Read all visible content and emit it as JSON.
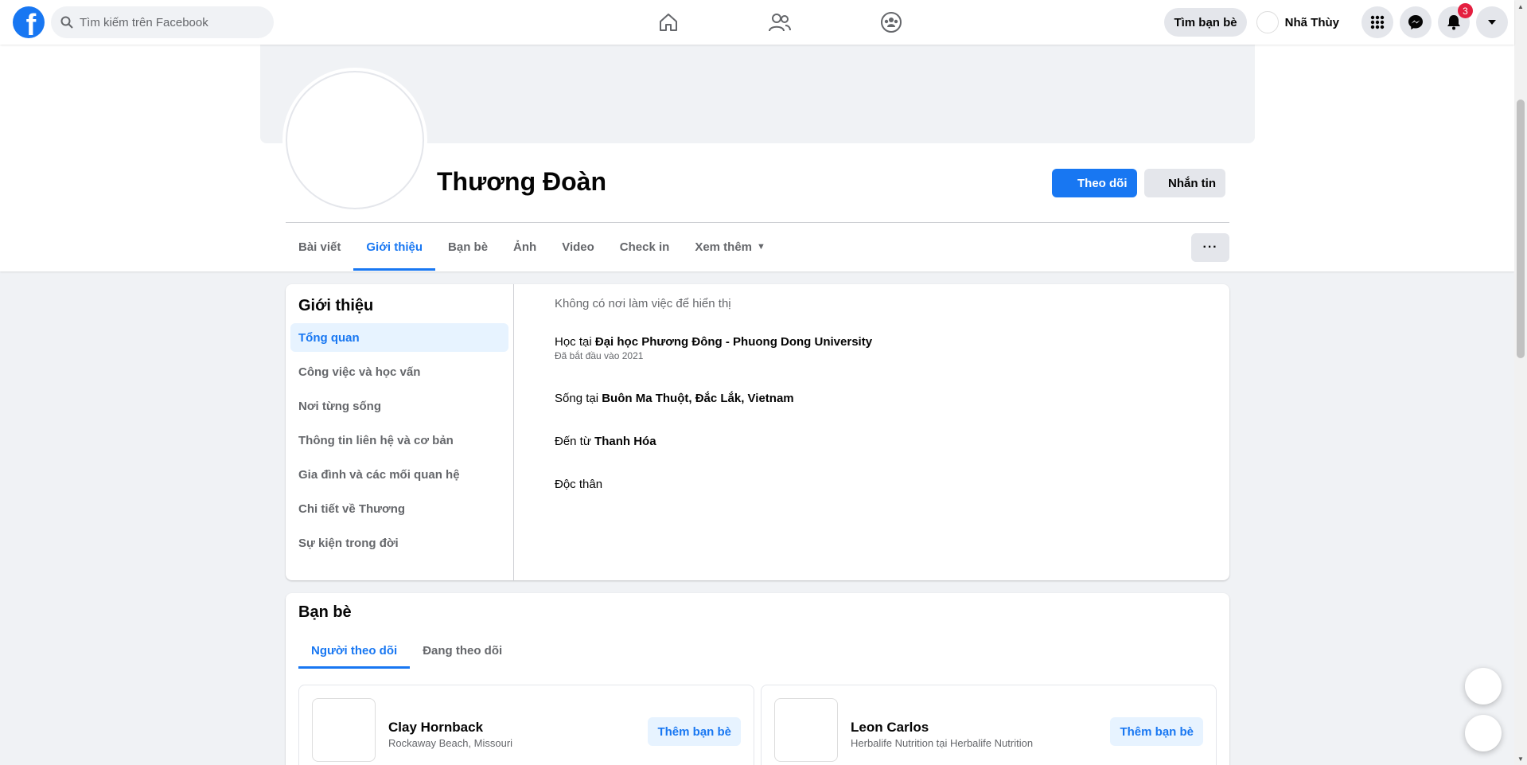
{
  "topbar": {
    "search_placeholder": "Tìm kiếm trên Facebook",
    "find_friends_label": "Tìm bạn bè",
    "user_name": "Nhã Thùy",
    "notification_count": "3",
    "brand_color": "#1877f2"
  },
  "profile": {
    "name": "Thương Đoàn",
    "follow_label": "Theo dõi",
    "message_label": "Nhắn tin",
    "more_label": "···",
    "tabs": [
      {
        "label": "Bài viết"
      },
      {
        "label": "Giới thiệu"
      },
      {
        "label": "Bạn bè"
      },
      {
        "label": "Ảnh"
      },
      {
        "label": "Video"
      },
      {
        "label": "Check in"
      },
      {
        "label": "Xem thêm"
      }
    ]
  },
  "about": {
    "title": "Giới thiệu",
    "nav": [
      {
        "label": "Tổng quan"
      },
      {
        "label": "Công việc và học vấn"
      },
      {
        "label": "Nơi từng sống"
      },
      {
        "label": "Thông tin liên hệ và cơ bản"
      },
      {
        "label": "Gia đình và các mối quan hệ"
      },
      {
        "label": "Chi tiết về Thương"
      },
      {
        "label": "Sự kiện trong đời"
      }
    ],
    "work": "Không có nơi làm việc để hiển thị",
    "study_prefix": "Học tại ",
    "study_place": "Đại học Phương Đông - Phuong Dong University",
    "study_start": "Đã bắt đầu vào 2021",
    "lives_prefix": "Sống tại ",
    "lives_place": "Buôn Ma Thuột, Đắc Lắk, Vietnam",
    "from_prefix": "Đến từ ",
    "from_place": "Thanh Hóa",
    "relationship": "Độc thân"
  },
  "friends": {
    "title": "Bạn bè",
    "tabs": [
      {
        "label": "Người theo dõi"
      },
      {
        "label": "Đang theo dõi"
      }
    ],
    "people": [
      {
        "name": "Clay Hornback",
        "sub": "Rockaway Beach, Missouri",
        "button": "Thêm bạn bè"
      },
      {
        "name": "Leon Carlos",
        "sub": "Herbalife Nutrition tại Herbalife Nutrition",
        "button": "Thêm bạn bè"
      }
    ]
  }
}
